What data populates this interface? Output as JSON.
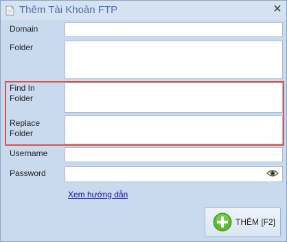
{
  "window": {
    "title": "Thêm Tài Khoản FTP",
    "close_glyph": "✕"
  },
  "form": {
    "domain_label": "Domain",
    "domain_value": "",
    "folder_label": "Folder",
    "folder_value": "",
    "find_label_line1": "Find In",
    "find_label_line2": "Folder",
    "find_value": "",
    "replace_label_line1": "Replace",
    "replace_label_line2": "Folder",
    "replace_value": "",
    "username_label": "Username",
    "username_value": "",
    "password_label": "Password",
    "password_value": ""
  },
  "help_link": "Xem hướng dẫn",
  "add_button": {
    "label": "THÊM [F2]"
  },
  "colors": {
    "highlight": "#d9534f",
    "accent_green": "#5cb82e",
    "title": "#4a6fa0"
  }
}
